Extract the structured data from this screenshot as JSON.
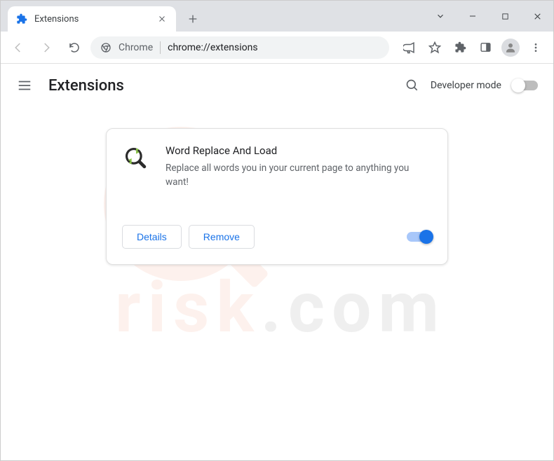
{
  "window": {
    "tab_title": "Extensions"
  },
  "omnibox": {
    "secure_label": "Chrome",
    "url": "chrome://extensions"
  },
  "header": {
    "title": "Extensions",
    "developer_mode_label": "Developer mode",
    "developer_mode_on": false
  },
  "extensions": [
    {
      "name": "Word Replace And Load",
      "description": "Replace all words you in your current page to anything you want!",
      "details_label": "Details",
      "remove_label": "Remove",
      "enabled": true
    }
  ],
  "icons": {
    "puzzle": "puzzle-icon",
    "close": "close-icon",
    "plus": "plus-icon",
    "back": "back-icon",
    "forward": "forward-icon",
    "reload": "reload-icon",
    "share": "share-icon",
    "star": "star-icon",
    "panel": "side-panel-icon",
    "menu": "menu-icon",
    "hamburger": "hamburger-icon",
    "search": "search-icon",
    "kebab": "kebab-icon",
    "chevron": "chevron-down-icon",
    "minimize": "minimize-icon",
    "maximize": "maximize-icon"
  }
}
